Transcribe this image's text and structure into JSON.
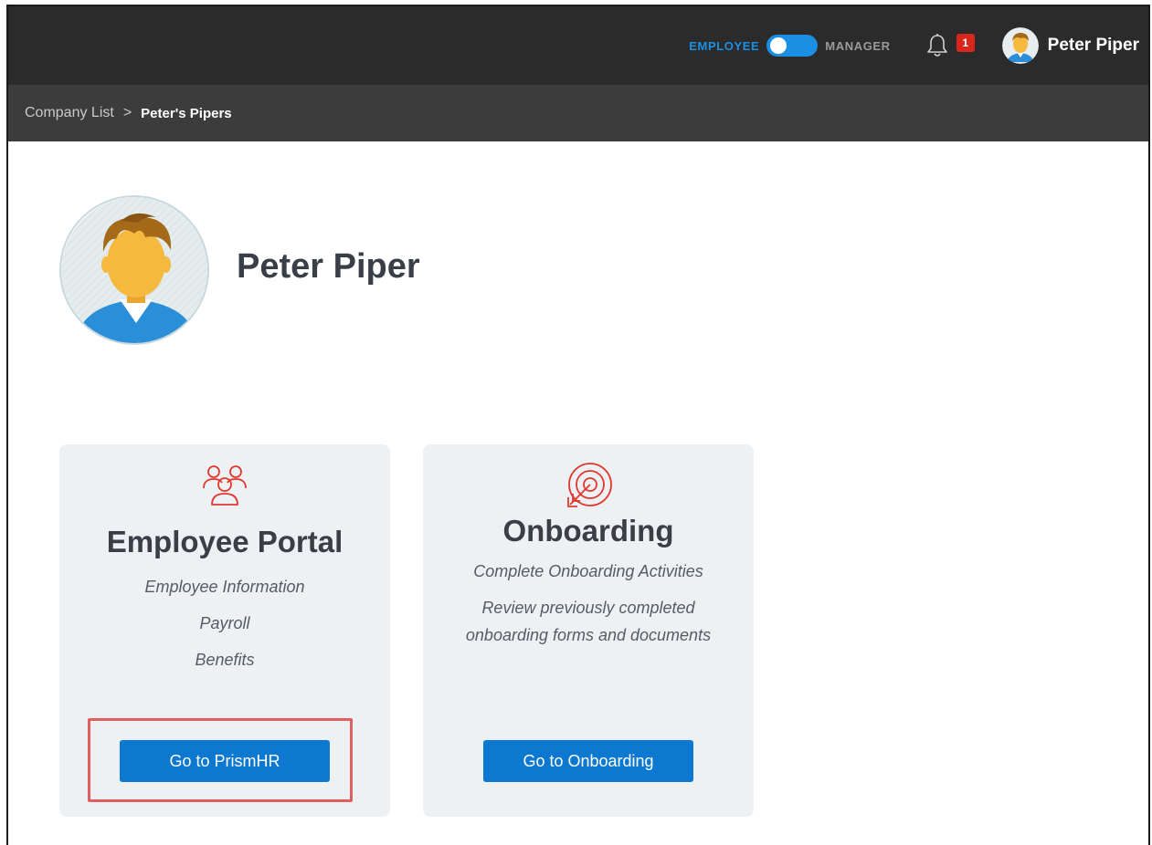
{
  "topbar": {
    "toggle": {
      "left_label": "EMPLOYEE",
      "right_label": "MANAGER",
      "selected": "EMPLOYEE"
    },
    "notifications": {
      "count": "1"
    },
    "user": {
      "name": "Peter Piper"
    }
  },
  "breadcrumb": {
    "items": [
      "Company List",
      "Peter's Pipers"
    ],
    "separator": ">"
  },
  "profile": {
    "name": "Peter Piper"
  },
  "cards": [
    {
      "icon": "people-group-icon",
      "title": "Employee Portal",
      "lines": [
        "Employee Information",
        "Payroll",
        "Benefits"
      ],
      "button": "Go to PrismHR"
    },
    {
      "icon": "target-arrow-icon",
      "title": "Onboarding",
      "lines": [
        "Complete Onboarding Activities",
        "Review previously completed",
        "onboarding forms and documents"
      ],
      "button": "Go to Onboarding"
    }
  ],
  "colors": {
    "topbar_bg": "#2b2b2b",
    "breadcrumb_bg": "#3c3c3c",
    "accent": "#1a8fe3",
    "button": "#0d78cf",
    "badge": "#d9261c",
    "icon_red": "#e0382e",
    "highlight": "#e06060"
  }
}
